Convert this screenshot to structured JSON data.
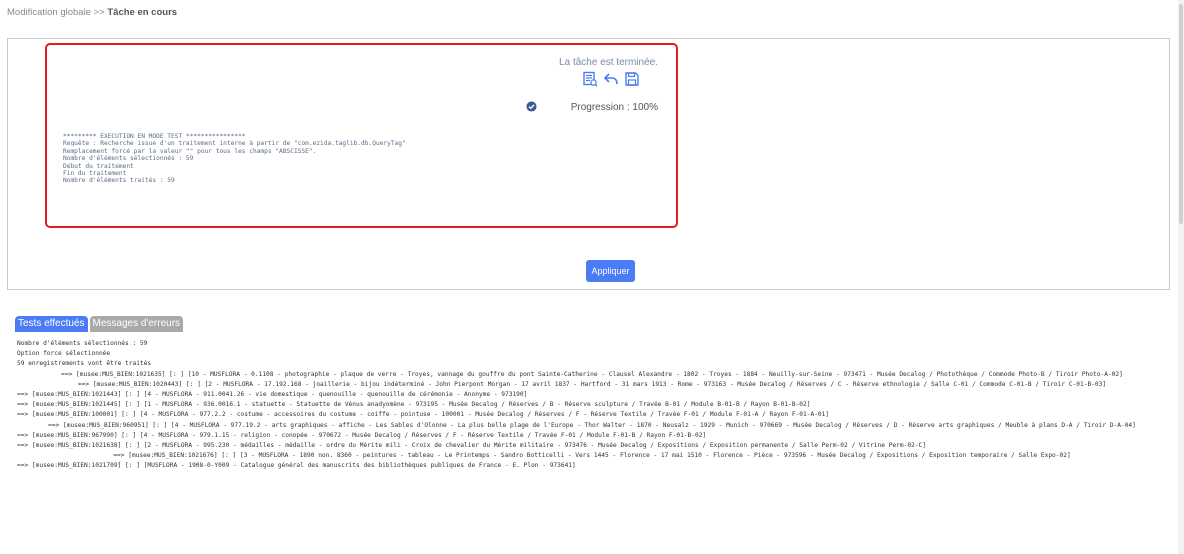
{
  "breadcrumb": {
    "parent": "Modification globale >>",
    "current": "Tâche en cours"
  },
  "task": {
    "status": "La tâche est terminée.",
    "icons": [
      "report-icon",
      "undo-icon",
      "save-icon",
      "check-circle-icon"
    ],
    "progress": "Progression : 100%",
    "log": [
      "********* EXECUTION EN MODE TEST ****************",
      "Requête : Recherche issue d'un traitement interne à partir de \"com.ezida.taglib.db.QueryTag\"",
      "Remplacement forcé par la valeur \"\" pour tous les champs \"ABSCISSE\".",
      "",
      "Nombre d'éléments sélectionnés : 59",
      "Début du traitement",
      "Fin du traitement",
      "Nombre d'éléments traités : 59"
    ]
  },
  "apply_button": "Appliquer",
  "tabs": [
    "Tests effectués",
    "Messages d'erreurs"
  ],
  "results": {
    "summary": [
      "Nombre d'éléments sélectionnés : 59",
      "Option force sélectionnée",
      "59 enregistrements vont être traités"
    ],
    "records": [
      "==> [musee:MUS_BIEN:1021635] [: ] [10 - MUSFLORA - 0.1108 - photographie - plaque de verre - Troyes, vannage du gouffre du pont Sainte-Catherine - Clausel Alexandre - 1802 - Troyes - 1884 - Neuilly-sur-Seine - 973471 - Musée Decalog / Photothèque / Commode Photo-B / Tiroir Photo-A-02]",
      "==> [musee:MUS_BIEN:1020443] [: ] [2 - MUSFLORA - 17.192.168 - joaillerie - bijou indéterminé - John Pierpont Morgan - 17 avril 1837 - Hartford - 31 mars 1913 - Rome - 973163 - Musée Decalog / Réserves / C - Réserve ethnologie / Salle C-01 / Commode C-01-B / Tiroir C-01-B-03]",
      "==> [musee:MUS_BIEN:1021443] [: ] [4 - MUSFLORA - 911.0041.26 - vie domestique - quenouille - quenouille de cérémonie - Anonyme - 973190]",
      "==> [musee:MUS_BIEN:1021445] [: ] [1 - MUSFLORA - 936.0016.1 - statuette - Statuette de Vénus anadyomène - 973195 - Musée Decalog / Réserves / B - Réserve sculpture / Travée B-01 / Module B-01-B / Rayon B-01-B-02]",
      "==> [musee:MUS_BIEN:100001] [: ] [4 - MUSFLORA - 977.2.2 - costume - accessoires du costume - coiffe - pointuse - 100001 - Musée Decalog / Réserves / F - Réserve Textile / Travée F-01 / Module F-01-A / Rayon F-01-A-01]",
      "==> [musee:MUS_BIEN:960951] [: ] [4 - MUSFLORA - 977.19.2 - arts graphiques - affiche - Les Sables d'Olonne - La plus belle plage de l'Europe - Thor Walter - 1870 - Neusalz - 1929 - Munich - 970669 - Musée Decalog / Réserves / D - Réserve arts graphiques / Meuble à plans D-A / Tiroir D-A-04]",
      "==> [musee:MUS_BIEN:967990] [: ] [4 - MUSFLORA - 979.1.15 - religion - conopée - 970672 - Musée Decalog / Réserves / F - Réserve Textile / Travée F-01 / Module F-01-B / Rayon F-01-B-02]",
      "==> [musee:MUS_BIEN:1021638] [: ] [2 - MUSFLORA - 995.230 - médailles - médaille - ordre du Mérite mili - Croix de chevalier du Mérite militaire - 973476 - Musée Decalog / Expositions / Exposition permanente / Salle Perm-02 / Vitrine Perm-02-C]",
      "==> [musee:MUS_BIEN:1021676] [: ] [3 - MUSFLORA - 1890 non. 8360 - peintures - tableau - Le Printemps - Sandro Botticelli - Vers 1445 - Florence - 17 mai 1510 - Florence - Pièce - 973596 - Musée Decalog / Expositions / Exposition temporaire / Salle Expo-02]",
      "==> [musee:MUS_BIEN:1021709] [: ] [MUSFLORA - 1908-0-Y009 - Catalogue général des manuscrits des bibliothèques publiques de France - E. Plon - 973641]"
    ]
  },
  "colors": {
    "accent": "#4b7bf5",
    "highlight_border": "#e01e1e",
    "tab_inactive": "#a9a9a9"
  }
}
